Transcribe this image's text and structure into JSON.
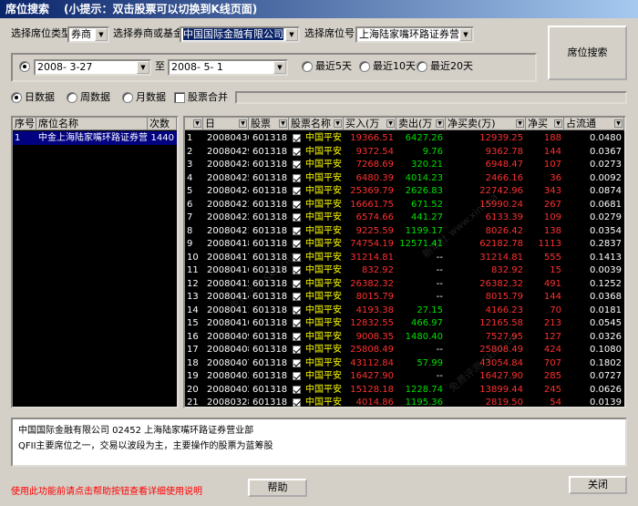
{
  "window": {
    "title": "席位搜索",
    "hint": "(小提示：双击股票可以切换到K线页面)"
  },
  "filters": {
    "seat_type_label": "选择席位类型",
    "seat_type_value": "券商",
    "broker_label": "选择券商或基金",
    "broker_value": "中国国际金融有限公司",
    "seat_no_label": "选择席位号",
    "seat_no_value": "上海陆家嘴环路证券营业",
    "search_button": "席位搜索"
  },
  "dates": {
    "start": "2008- 3-27",
    "to": "至",
    "end": "2008- 5- 1",
    "recent5": "最近5天",
    "recent10": "最近10天",
    "recent20": "最近20天"
  },
  "period": {
    "day": "日数据",
    "week": "周数据",
    "month": "月数据",
    "merge": "股票合并"
  },
  "left_table": {
    "headers": [
      "序号",
      "席位名称",
      "次数"
    ],
    "rows": [
      {
        "no": "1",
        "name": "中金上海陆家嘴环路证券营",
        "count": "1440"
      }
    ]
  },
  "right_table": {
    "headers": [
      "",
      "日",
      "股票",
      "股票名称",
      "买入(万",
      "卖出(万",
      "净买卖(万)",
      "净买",
      "占流通"
    ],
    "rows": [
      {
        "no": "1",
        "date": "20080430",
        "code": "601318",
        "name": "中国平安",
        "buy": "19366.51",
        "sell": "6427.26",
        "net": "12939.25",
        "net_vol": "188",
        "ratio": "0.0480"
      },
      {
        "no": "2",
        "date": "20080429",
        "code": "601318",
        "name": "中国平安",
        "buy": "9372.54",
        "sell": "9.76",
        "net": "9362.78",
        "net_vol": "144",
        "ratio": "0.0367"
      },
      {
        "no": "3",
        "date": "20080428",
        "code": "601318",
        "name": "中国平安",
        "buy": "7268.69",
        "sell": "320.21",
        "net": "6948.47",
        "net_vol": "107",
        "ratio": "0.0273"
      },
      {
        "no": "4",
        "date": "20080425",
        "code": "601318",
        "name": "中国平安",
        "buy": "6480.39",
        "sell": "4014.23",
        "net": "2466.16",
        "net_vol": "36",
        "ratio": "0.0092"
      },
      {
        "no": "5",
        "date": "20080424",
        "code": "601318",
        "name": "中国平安",
        "buy": "25369.79",
        "sell": "2626.83",
        "net": "22742.96",
        "net_vol": "343",
        "ratio": "0.0874"
      },
      {
        "no": "6",
        "date": "20080423",
        "code": "601318",
        "name": "中国平安",
        "buy": "16661.75",
        "sell": "671.52",
        "net": "15990.24",
        "net_vol": "267",
        "ratio": "0.0681"
      },
      {
        "no": "7",
        "date": "20080422",
        "code": "601318",
        "name": "中国平安",
        "buy": "6574.66",
        "sell": "441.27",
        "net": "6133.39",
        "net_vol": "109",
        "ratio": "0.0279"
      },
      {
        "no": "8",
        "date": "20080421",
        "code": "601318",
        "name": "中国平安",
        "buy": "9225.59",
        "sell": "1199.17",
        "net": "8026.42",
        "net_vol": "138",
        "ratio": "0.0354"
      },
      {
        "no": "9",
        "date": "20080418",
        "code": "601318",
        "name": "中国平安",
        "buy": "74754.19",
        "sell": "12571.41",
        "net": "62182.78",
        "net_vol": "1113",
        "ratio": "0.2837"
      },
      {
        "no": "10",
        "date": "20080417",
        "code": "601318",
        "name": "中国平安",
        "buy": "31214.81",
        "sell": "--",
        "net": "31214.81",
        "net_vol": "555",
        "ratio": "0.1413"
      },
      {
        "no": "11",
        "date": "20080416",
        "code": "601318",
        "name": "中国平安",
        "buy": "832.92",
        "sell": "--",
        "net": "832.92",
        "net_vol": "15",
        "ratio": "0.0039"
      },
      {
        "no": "12",
        "date": "20080415",
        "code": "601318",
        "name": "中国平安",
        "buy": "26382.32",
        "sell": "--",
        "net": "26382.32",
        "net_vol": "491",
        "ratio": "0.1252"
      },
      {
        "no": "13",
        "date": "20080414",
        "code": "601318",
        "name": "中国平安",
        "buy": "8015.79",
        "sell": "--",
        "net": "8015.79",
        "net_vol": "144",
        "ratio": "0.0368"
      },
      {
        "no": "14",
        "date": "20080411",
        "code": "601318",
        "name": "中国平安",
        "buy": "4193.38",
        "sell": "27.15",
        "net": "4166.23",
        "net_vol": "70",
        "ratio": "0.0181"
      },
      {
        "no": "15",
        "date": "20080410",
        "code": "601318",
        "name": "中国平安",
        "buy": "12832.55",
        "sell": "466.97",
        "net": "12165.58",
        "net_vol": "213",
        "ratio": "0.0545"
      },
      {
        "no": "16",
        "date": "20080409",
        "code": "601318",
        "name": "中国平安",
        "buy": "9008.35",
        "sell": "1480.40",
        "net": "7527.95",
        "net_vol": "127",
        "ratio": "0.0326"
      },
      {
        "no": "17",
        "date": "20080408",
        "code": "601318",
        "name": "中国平安",
        "buy": "25808.49",
        "sell": "--",
        "net": "25808.49",
        "net_vol": "424",
        "ratio": "0.1080"
      },
      {
        "no": "18",
        "date": "20080407",
        "code": "601318",
        "name": "中国平安",
        "buy": "43112.84",
        "sell": "57.99",
        "net": "43054.84",
        "net_vol": "707",
        "ratio": "0.1802"
      },
      {
        "no": "19",
        "date": "20080403",
        "code": "601318",
        "name": "中国平安",
        "buy": "16427.90",
        "sell": "--",
        "net": "16427.90",
        "net_vol": "285",
        "ratio": "0.0727"
      },
      {
        "no": "20",
        "date": "20080402",
        "code": "601318",
        "name": "中国平安",
        "buy": "15128.18",
        "sell": "1228.74",
        "net": "13899.44",
        "net_vol": "245",
        "ratio": "0.0626"
      },
      {
        "no": "21",
        "date": "20080328",
        "code": "601318",
        "name": "中国平安",
        "buy": "4014.86",
        "sell": "1195.36",
        "net": "2819.50",
        "net_vol": "54",
        "ratio": "0.0139"
      }
    ]
  },
  "info": {
    "line1": "中国国际金融有限公司 02452  上海陆家嘴环路证券营业部",
    "line2": "QFII主要席位之一，交易以波段为主，主要操作的股票为蓝筹股"
  },
  "footer": {
    "help_note": "使用此功能前请点击帮助按钮查看详细使用说明",
    "help_button": "帮助",
    "close_button": "关闭"
  },
  "colors": {
    "title_bg": "#0a246a",
    "grid_bg": "#000000",
    "buy": "#ff3030",
    "sell": "#00e000",
    "name": "#ffff00"
  }
}
